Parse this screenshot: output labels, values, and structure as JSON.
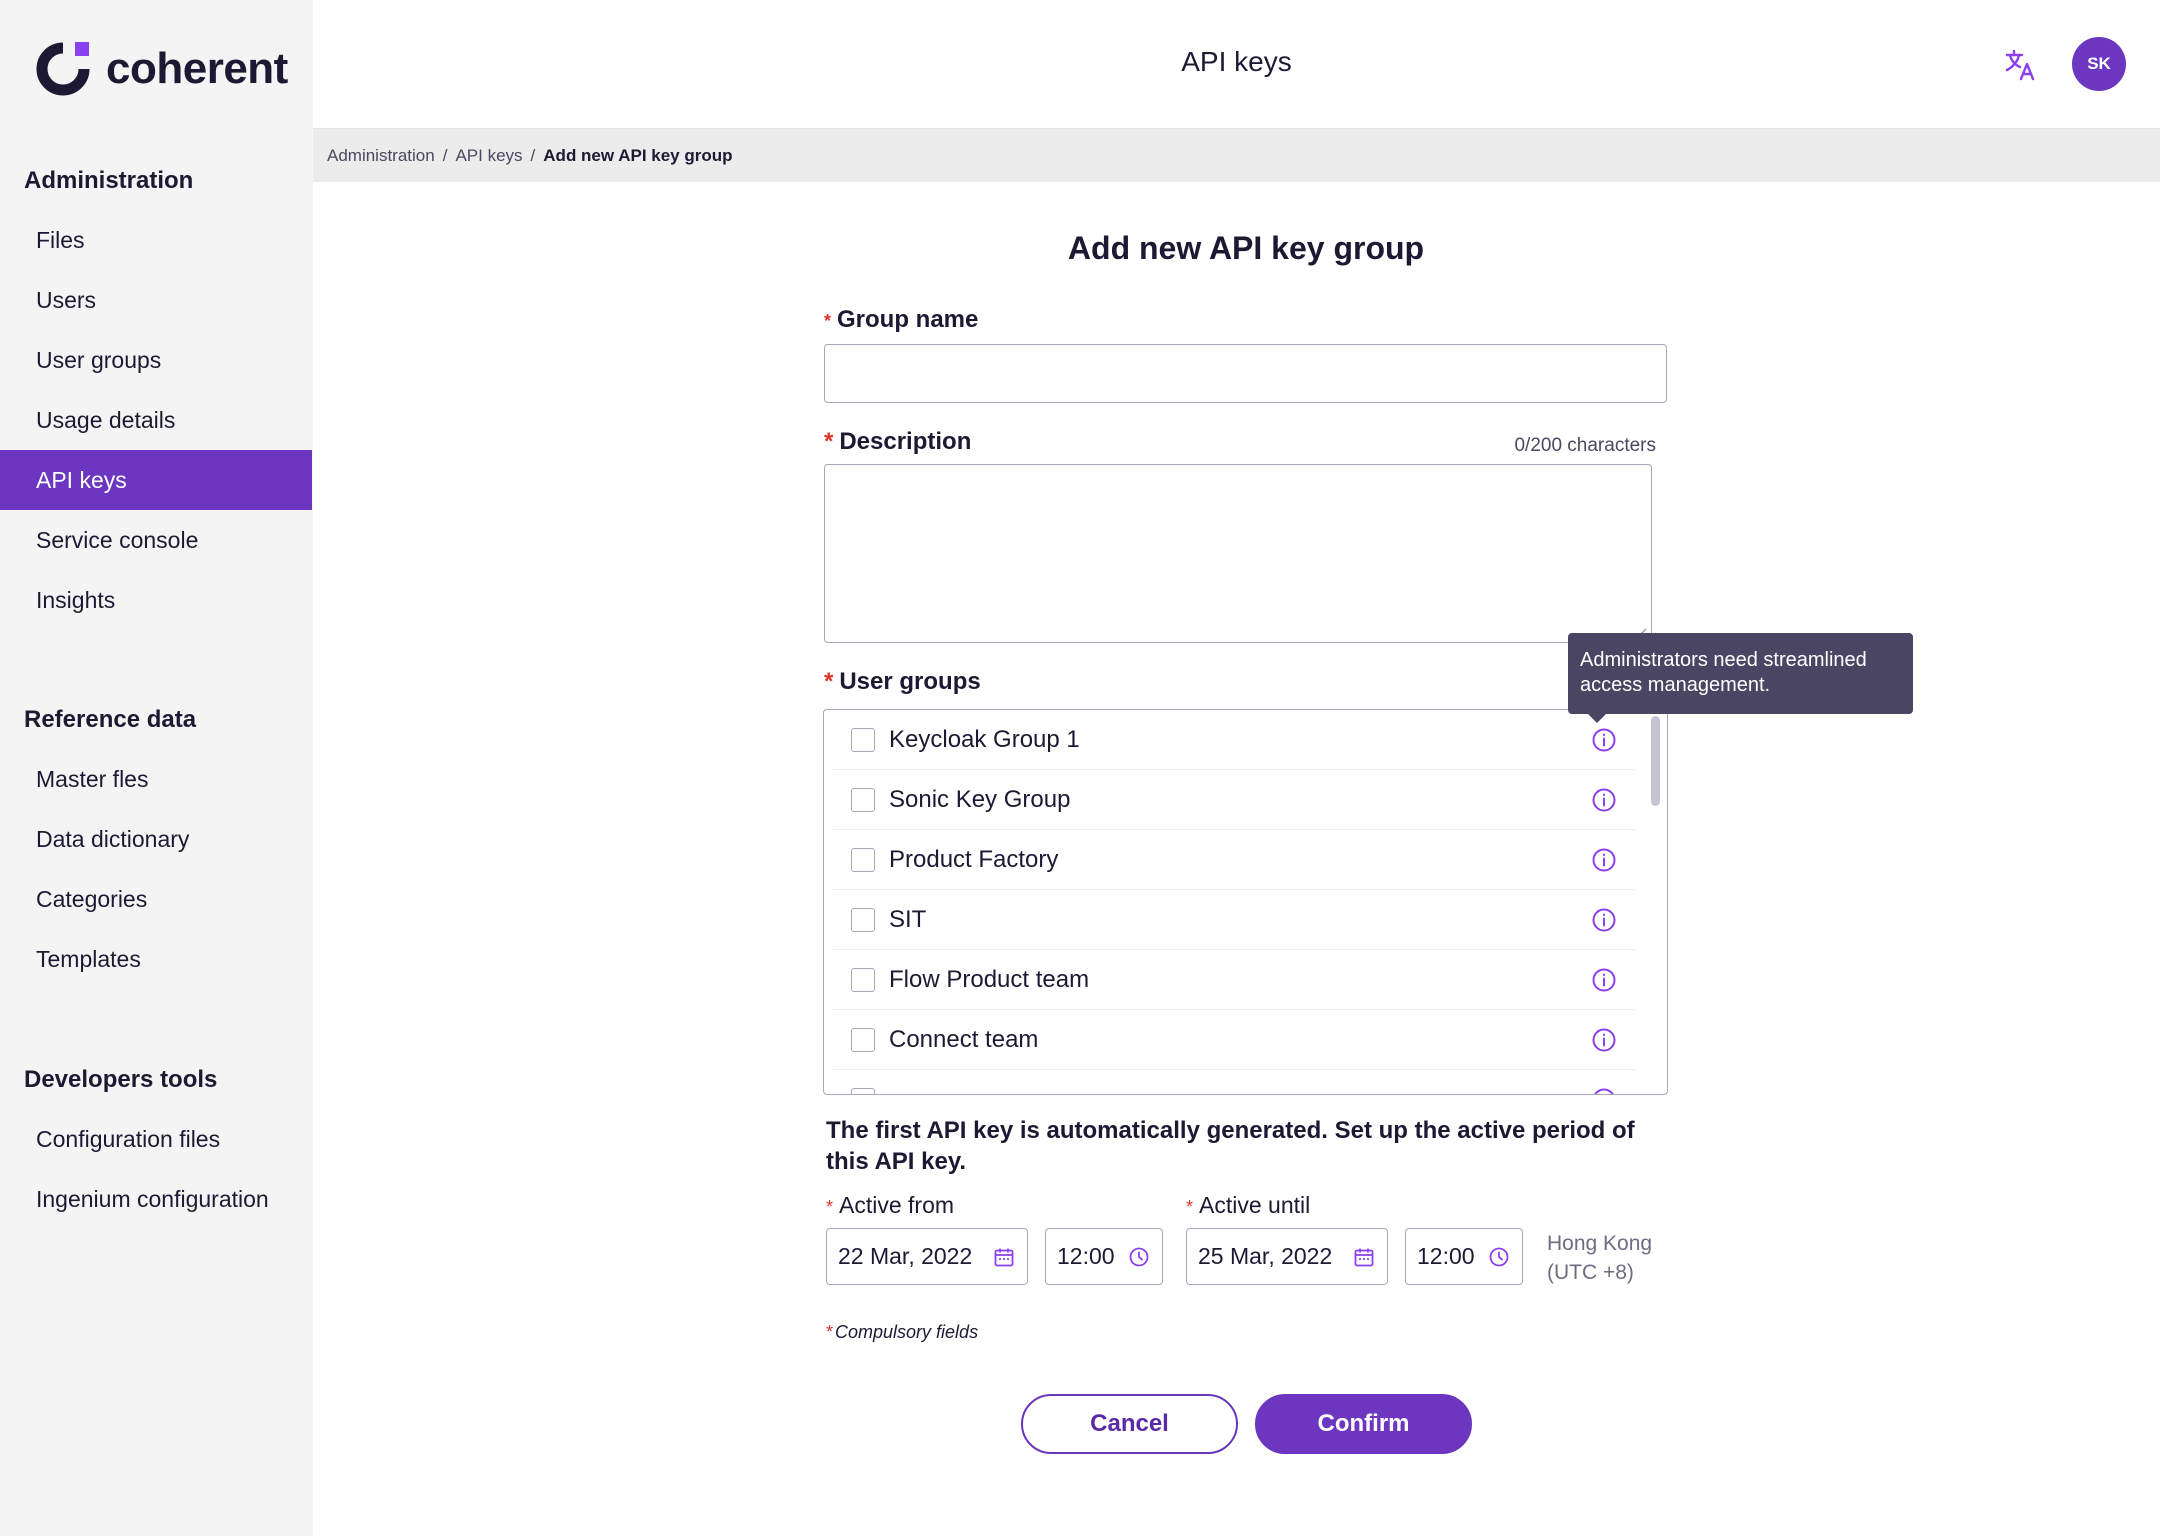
{
  "brand": {
    "name": "coherent",
    "accent": "#6c36c0"
  },
  "header": {
    "title": "API keys",
    "avatar_initials": "SK",
    "translate_icon": "translate-icon"
  },
  "sidebar": {
    "sections": [
      {
        "title": "Administration",
        "items": [
          {
            "label": "Files",
            "active": false
          },
          {
            "label": "Users",
            "active": false
          },
          {
            "label": "User groups",
            "active": false
          },
          {
            "label": "Usage details",
            "active": false
          },
          {
            "label": "API keys",
            "active": true
          },
          {
            "label": "Service console",
            "active": false
          },
          {
            "label": "Insights",
            "active": false
          }
        ]
      },
      {
        "title": "Reference data",
        "items": [
          {
            "label": "Master fles",
            "active": false
          },
          {
            "label": "Data dictionary",
            "active": false
          },
          {
            "label": "Categories",
            "active": false
          },
          {
            "label": "Templates",
            "active": false
          }
        ]
      },
      {
        "title": "Developers tools",
        "items": [
          {
            "label": "Configuration  files",
            "active": false
          },
          {
            "label": "Ingenium configuration",
            "active": false
          }
        ]
      }
    ]
  },
  "breadcrumb": {
    "items": [
      "Administration",
      "API keys"
    ],
    "current": "Add new API key group",
    "separator": "/"
  },
  "form": {
    "title": "Add new API key group",
    "required_mark": "*",
    "group_name": {
      "label": "Group name",
      "value": ""
    },
    "description": {
      "label": "Description",
      "value": "",
      "counter": "0/200 characters"
    },
    "user_groups": {
      "label": "User groups",
      "tooltip": "Administrators need streamlined access management.",
      "items": [
        {
          "label": "Keycloak Group 1",
          "checked": false
        },
        {
          "label": "Sonic Key Group",
          "checked": false
        },
        {
          "label": "Product Factory",
          "checked": false
        },
        {
          "label": "SIT",
          "checked": false
        },
        {
          "label": "Flow Product team",
          "checked": false
        },
        {
          "label": "Connect team",
          "checked": false
        }
      ]
    },
    "api_key_info": "The first API key is automatically generated. Set up the active period of this API key.",
    "active_from": {
      "label": "Active from",
      "date": "22 Mar, 2022",
      "time": "12:00"
    },
    "active_until": {
      "label": "Active until",
      "date": "25 Mar, 2022",
      "time": "12:00"
    },
    "timezone": {
      "line1": "Hong Kong",
      "line2": "(UTC +8)"
    },
    "compulsory_note": "Compulsory fields",
    "cancel_label": "Cancel",
    "confirm_label": "Confirm"
  }
}
